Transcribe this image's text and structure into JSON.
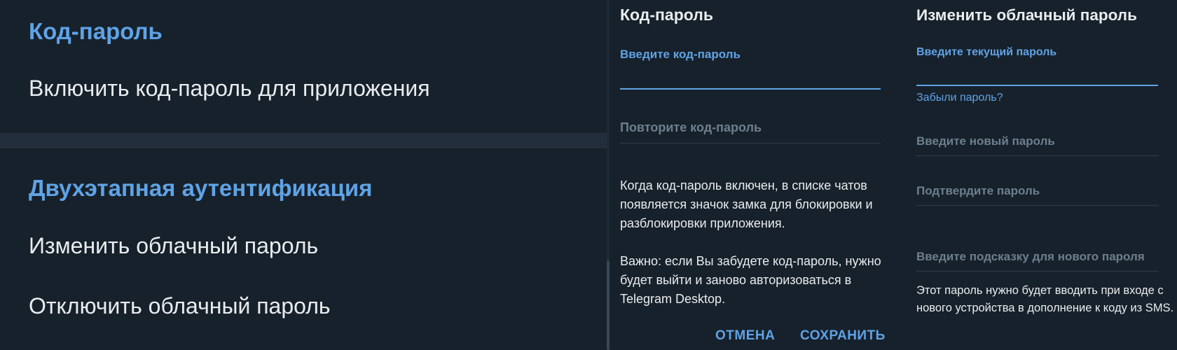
{
  "settings": {
    "passcode_section_title": "Код-пароль",
    "enable_passcode_item": "Включить код-пароль для приложения",
    "two_step_section_title": "Двухэтапная аутентификация",
    "change_cloud_password_item": "Изменить облачный пароль",
    "disable_cloud_password_item": "Отключить облачный пароль"
  },
  "passcode_box": {
    "title": "Код-пароль",
    "enter_label": "Введите код-пароль",
    "repeat_placeholder": "Повторите код-пароль",
    "info_paragraph_1": "Когда код-пароль включен, в списке чатов появляется значок замка для блокировки и разблокировки приложения.",
    "info_paragraph_2": "Важно: если Вы забудете код-пароль, нужно будет выйти и заново авторизоваться в Telegram Desktop.",
    "cancel_button": "ОТМЕНА",
    "save_button": "СОХРАНИТЬ"
  },
  "cloud_password_box": {
    "title": "Изменить облачный пароль",
    "current_label": "Введите текущий пароль",
    "forgot_link": "Забыли пароль?",
    "new_placeholder": "Введите новый пароль",
    "confirm_placeholder": "Подтвердите пароль",
    "hint_placeholder": "Введите подсказку для нового пароля",
    "info_text": "Этот пароль нужно будет вводить при входе с нового устройства в дополнение к коду из SMS."
  },
  "colors": {
    "background": "#17212b",
    "accent": "#5fa3e6",
    "text": "#e9ecef",
    "placeholder": "#6d7f8f",
    "separator": "#232e3c"
  }
}
